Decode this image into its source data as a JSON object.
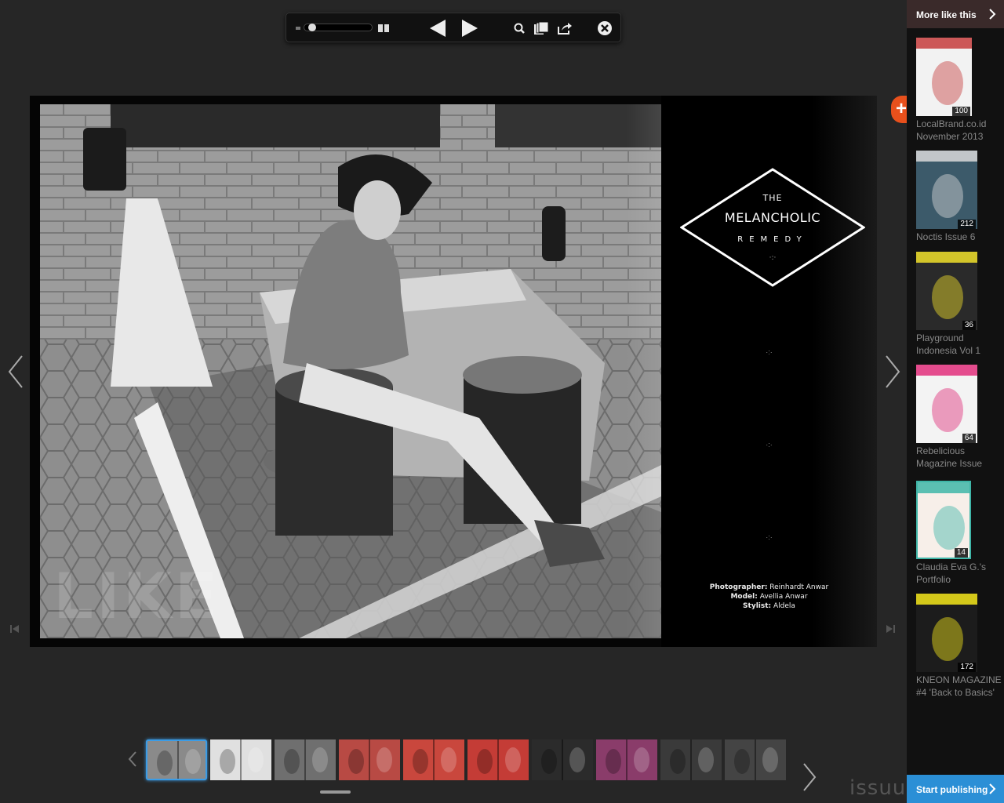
{
  "toolbar": {
    "zoom_level": 0.05,
    "icons": [
      "page-size-icon",
      "two-page-icon",
      "previous-page-icon",
      "next-page-icon",
      "search-icon",
      "library-icon",
      "share-icon",
      "close-icon"
    ]
  },
  "publication": {
    "left_page": {
      "watermark": "LIKE"
    },
    "right_page": {
      "title_line1": "THE",
      "title_line2": "MELANCHOLIC",
      "title_line3": "REMEDY",
      "ornament": "·:·",
      "credits": [
        {
          "role": "Photographer:",
          "name": "Reinhardt Anwar"
        },
        {
          "role": "Model:",
          "name": "Avellia Anwar"
        },
        {
          "role": "Stylist:",
          "name": "Aldela"
        }
      ]
    }
  },
  "sidebar": {
    "header": "More like this",
    "items": [
      {
        "title": "LocalBrand.co.id November 2013",
        "pages": "100",
        "accent": "#c53d3d",
        "bg": "#f2f2f2"
      },
      {
        "title": "Noctis Issue 6",
        "pages": "212",
        "accent": "#d9d9d9",
        "bg": "#3c5a6a"
      },
      {
        "title": "Playground Indonesia Vol 1",
        "pages": "36",
        "accent": "#f1e12a",
        "bg": "#2a2a2a"
      },
      {
        "title": "Rebelicious Magazine Issue",
        "pages": "64",
        "accent": "#e02e7a",
        "bg": "#f3f3f3"
      },
      {
        "title": "Claudia Eva G.'s Portfolio",
        "pages": "14",
        "accent": "#3fb6a8",
        "bg": "#f7efe9"
      },
      {
        "title": "KNEON MAGAZINE #4 'Back to Basics'",
        "pages": "172",
        "accent": "#f4e61a",
        "bg": "#1c1c1c"
      }
    ],
    "footer": "Start publishing"
  },
  "footer": {
    "logo": "issuu"
  },
  "thumbnails": [
    {
      "tone": "#8a8a8a",
      "active": true
    },
    {
      "tone": "#e0e0e0"
    },
    {
      "tone": "#6f6f6f"
    },
    {
      "tone": "#b84a44"
    },
    {
      "tone": "#c9473d"
    },
    {
      "tone": "#c43c36"
    },
    {
      "tone": "#2b2b2b"
    },
    {
      "tone": "#8a3c6a"
    },
    {
      "tone": "#3a3a3a"
    },
    {
      "tone": "#444444"
    }
  ],
  "colors": {
    "accent_blue": "#2b8fd6",
    "plus_orange": "#e8501c"
  }
}
